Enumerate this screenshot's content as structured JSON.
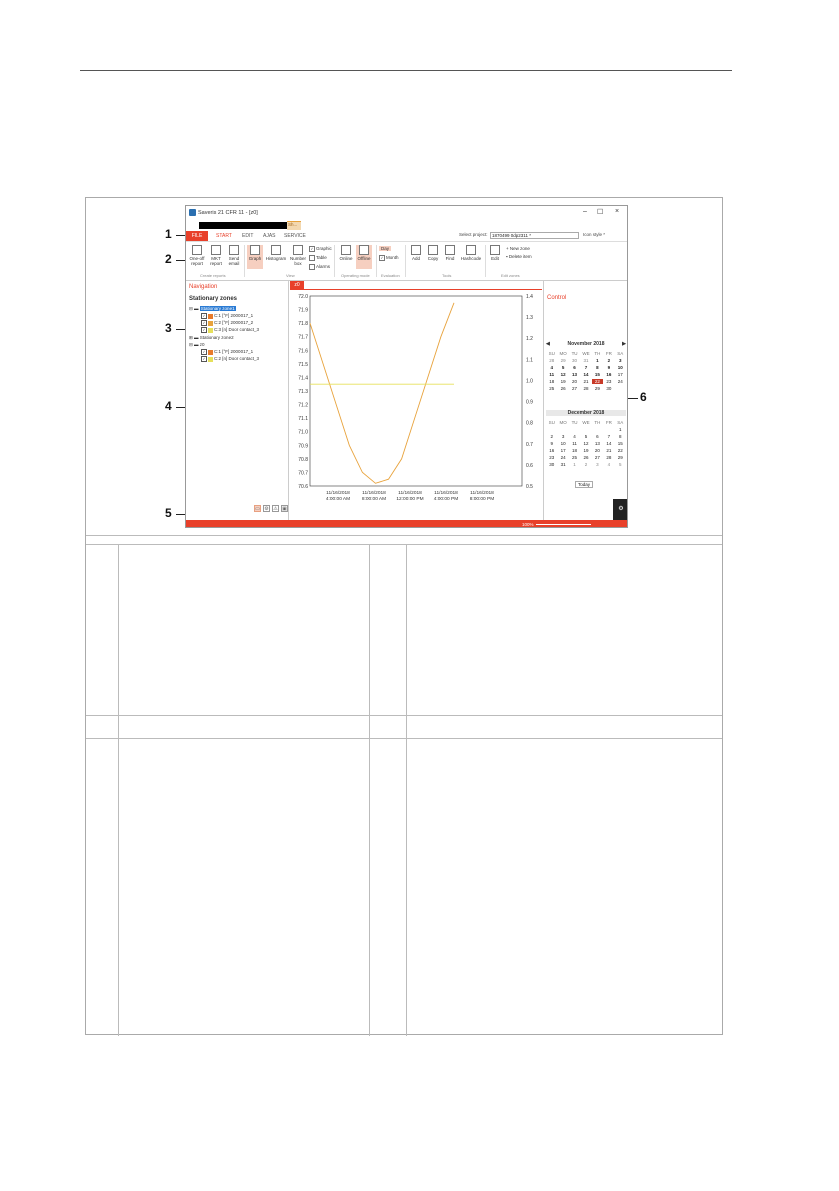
{
  "window": {
    "title": "Saveris 21 CFR 11 - [z0]",
    "mini_tab": "Sh...",
    "zoom": "100%",
    "select_project_label": "Select project:",
    "project_value": "1870499 0dp2311 *",
    "icon_style": "Icon style *",
    "close_glyph": "×",
    "min_glyph": "–",
    "max_glyph": "☐"
  },
  "menu": {
    "file": "FILE",
    "start": "START",
    "edit": "EDIT",
    "ajas": "AJAS",
    "service": "SERVICE"
  },
  "ribbon": {
    "oneoff": "One-off report",
    "mkt": "MKT report",
    "send": "Send email",
    "create_reports": "Create reports",
    "graph": "Graph",
    "histogram": "Histogram",
    "number_box": "Number box",
    "graphic": "Graphic",
    "table": "Table",
    "alarms": "Alarms",
    "view": "View",
    "online": "Online",
    "offline": "Offline",
    "operating_mode": "Operating mode",
    "day": "Day",
    "month": "Month",
    "evaluation": "Evaluation",
    "add": "Add",
    "copy": "Copy",
    "find": "Find",
    "hashcode": "Hashcode",
    "tools": "Tools",
    "edit": "Edit",
    "new_zone": "New zone",
    "delete_item": "Delete item",
    "edit_zones": "Edit zones"
  },
  "nav": {
    "title": "Navigation",
    "heading": "Stationary zones",
    "zone1": "Stationary zone1",
    "zone1_ch1": "C:1 [°F] 2000017_1",
    "zone1_ch2": "C:2 [°F] 2000017_2",
    "zone1_ch3": "C:3 [n] Door contact_3",
    "zone2": "Stationary zone2",
    "z0": "z0",
    "z0_ch1": "C:1 [°F] 2000017_1",
    "z0_ch2": "C:2 [n] Door contact_3"
  },
  "doc_tab": "z0",
  "control": {
    "title": "Control",
    "nov_title": "November 2018",
    "dec_title": "December 2018",
    "today": "Today",
    "dow": [
      "SU",
      "MO",
      "TU",
      "WE",
      "TH",
      "FR",
      "SA"
    ],
    "nov_days": [
      "28",
      "29",
      "30",
      "31",
      "1",
      "2",
      "3",
      "4",
      "5",
      "6",
      "7",
      "8",
      "9",
      "10",
      "11",
      "12",
      "13",
      "14",
      "15",
      "16",
      "17",
      "18",
      "19",
      "20",
      "21",
      "22",
      "23",
      "24",
      "25",
      "26",
      "27",
      "28",
      "29",
      "30"
    ],
    "dec_days": [
      "",
      "",
      "",
      "",
      "",
      "",
      "1",
      "2",
      "3",
      "4",
      "5",
      "6",
      "7",
      "8",
      "9",
      "10",
      "11",
      "12",
      "13",
      "14",
      "15",
      "16",
      "17",
      "18",
      "19",
      "20",
      "21",
      "22",
      "23",
      "24",
      "25",
      "26",
      "27",
      "28",
      "29",
      "30",
      "31",
      "1",
      "2",
      "3",
      "4",
      "5"
    ]
  },
  "callouts": [
    "1",
    "2",
    "3",
    "4",
    "5",
    "6"
  ],
  "chart_data": {
    "type": "line",
    "y_left_ticks": [
      "72.0",
      "71.9",
      "71.8",
      "71.7",
      "71.6",
      "71.5",
      "71.4",
      "71.3",
      "71.2",
      "71.1",
      "71.0",
      "70.9",
      "70.8",
      "70.7",
      "70.6"
    ],
    "y_right_ticks": [
      "1.4",
      "1.3",
      "1.2",
      "1.1",
      "1.0",
      "0.9",
      "0.8",
      "0.7",
      "0.6",
      "0.5"
    ],
    "x_ticks": [
      {
        "date": "11/16/2018",
        "time": "4:00:00 AM"
      },
      {
        "date": "11/16/2018",
        "time": "8:00:00 AM"
      },
      {
        "date": "11/16/2018",
        "time": "12:00:00 PM"
      },
      {
        "date": "11/16/2018",
        "time": "4:00:00 PM"
      },
      {
        "date": "11/16/2018",
        "time": "8:00:00 PM"
      }
    ],
    "ylim_left": [
      70.6,
      72.0
    ],
    "ylim_right": [
      0.5,
      1.4
    ],
    "series": [
      {
        "color": "#e8a33d",
        "values": [
          71.8,
          71.5,
          71.2,
          70.9,
          70.7,
          70.62,
          70.65,
          70.8,
          71.1,
          71.4,
          71.7,
          71.95
        ]
      },
      {
        "color": "#e6e05a",
        "values": [
          71.35,
          71.35,
          71.35,
          71.35,
          71.35,
          71.35,
          71.35,
          71.35,
          71.35,
          71.35,
          71.35,
          71.35
        ]
      }
    ]
  }
}
